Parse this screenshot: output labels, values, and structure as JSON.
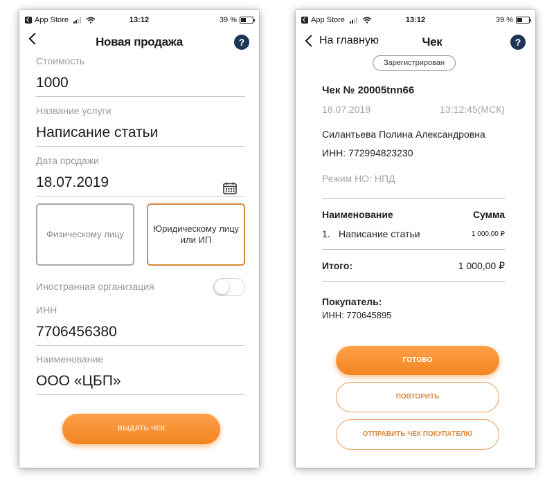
{
  "status": {
    "carrier": "App Store",
    "time": "13:12",
    "battery": "39 %"
  },
  "left": {
    "title": "Новая продажа",
    "help": "?",
    "fields": {
      "cost_label": "Стоимость",
      "cost_value": "1000",
      "service_label": "Название услуги",
      "service_value": "Написание статьи",
      "date_label": "Дата продажи",
      "date_value": "18.07.2019",
      "inn_label": "ИНН",
      "inn_value": "7706456380",
      "name_label": "Наименование",
      "name_value": "ООО «ЦБП»"
    },
    "choices": {
      "individual": "Физическому лицу",
      "legal": "Юридическому лицу или ИП",
      "selected": "legal"
    },
    "foreign_label": "Иностранная организация",
    "foreign_enabled": false,
    "issue_button": "ВЫДАТЬ ЧЕК"
  },
  "right": {
    "back_label": "На главную",
    "title": "Чек",
    "help": "?",
    "badge": "Зарегистрирован",
    "receipt_number": "Чек № 20005tnn66",
    "date": "18.07.2019",
    "time": "13:12:45(МСК)",
    "seller_name": "Силантьева Полина Александровна",
    "seller_inn": "ИНН: 772994823230",
    "tax_mode": "Режим НО: НПД",
    "col_name": "Наименование",
    "col_sum": "Сумма",
    "items": [
      {
        "num": "1.",
        "name": "Написание статьи",
        "sum": "1 000,00 ₽"
      }
    ],
    "total_label": "Итого:",
    "total_value": "1 000,00 ₽",
    "buyer_label": "Покупатель:",
    "buyer_inn": "ИНН: 770645895",
    "done_button": "ГОТОВО",
    "repeat_button": "ПОВТОРИТЬ",
    "send_button": "ОТПРАВИТЬ ЧЕК ПОКУПАТЕЛЮ"
  },
  "colors": {
    "accent": "#f28520",
    "help_icon": "#1e3557"
  }
}
